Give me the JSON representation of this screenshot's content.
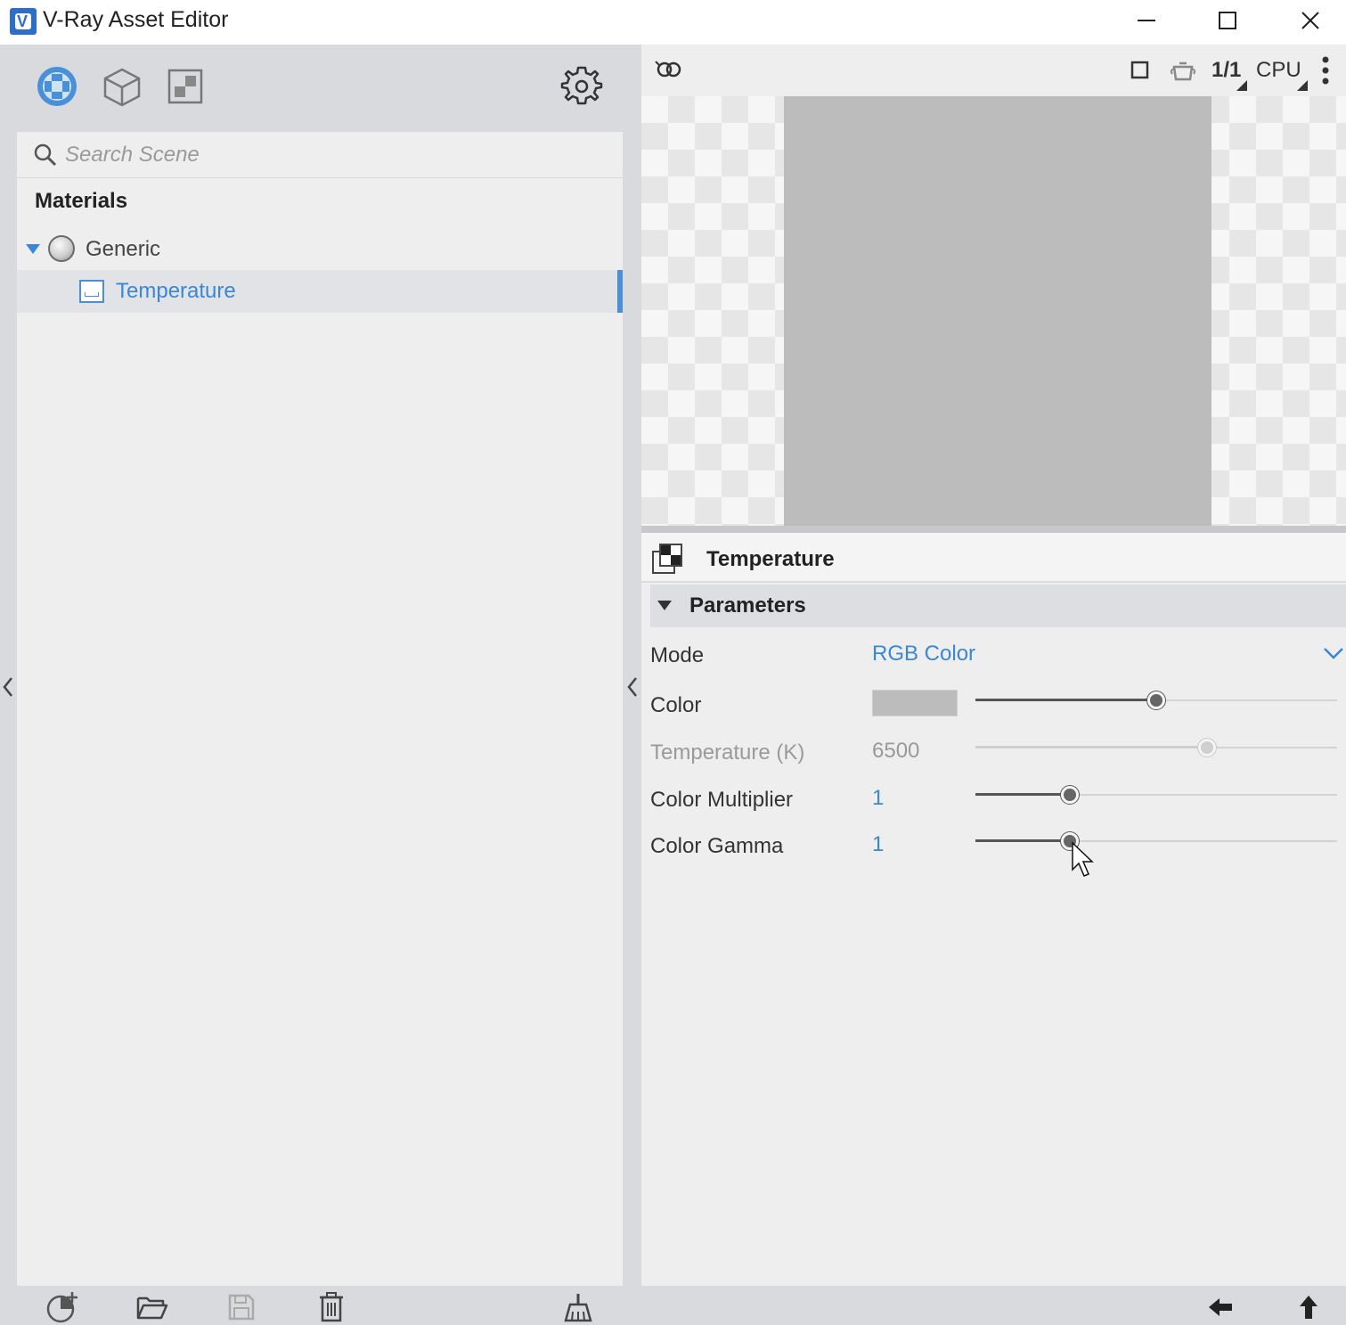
{
  "window": {
    "title": "V-Ray Asset Editor",
    "logo_glyph": "V"
  },
  "left_toolbar": {
    "icons": [
      "materials-icon",
      "geometry-icon",
      "textures-icon",
      "settings-gear-icon"
    ]
  },
  "search": {
    "placeholder": "Search Scene",
    "value": ""
  },
  "tree": {
    "heading": "Materials",
    "items": [
      {
        "label": "Generic",
        "expanded": true
      },
      {
        "label": "Temperature",
        "selected": true
      }
    ]
  },
  "render_toolbar": {
    "resolution_label": "1/1",
    "engine_label": "CPU"
  },
  "asset": {
    "title": "Temperature"
  },
  "parameters": {
    "title": "Parameters",
    "rows": [
      {
        "label": "Mode",
        "value": "RGB Color"
      },
      {
        "label": "Color",
        "value": "",
        "color": "#bcbcbc",
        "slider": 0.5
      },
      {
        "label": "Temperature (K)",
        "value": "6500",
        "disabled": true,
        "slider": 0.64
      },
      {
        "label": "Color Multiplier",
        "value": "1",
        "slider": 0.26
      },
      {
        "label": "Color Gamma",
        "value": "1",
        "slider": 0.26
      }
    ]
  },
  "colors": {
    "accent": "#3a87d6",
    "panel": "#eeeeee",
    "sidebar": "#d8dadd"
  }
}
